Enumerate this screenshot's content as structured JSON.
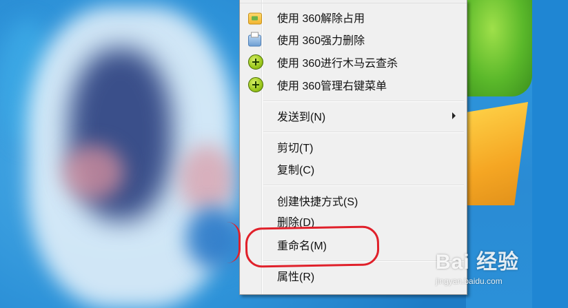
{
  "menu": {
    "items": [
      {
        "label": "使用 360解除占用",
        "icon": "folder-unlock-icon"
      },
      {
        "label": "使用 360强力删除",
        "icon": "shredder-icon"
      },
      {
        "label": "使用 360进行木马云查杀",
        "icon": "360-plus-icon"
      },
      {
        "label": "使用 360管理右键菜单",
        "icon": "360-plus-icon"
      },
      {
        "label": "发送到(N)",
        "submenu": true
      },
      {
        "label": "剪切(T)"
      },
      {
        "label": "复制(C)"
      },
      {
        "label": "创建快捷方式(S)"
      },
      {
        "label": "删除(D)"
      },
      {
        "label": "重命名(M)",
        "highlighted_by_annotation": true
      },
      {
        "label": "属性(R)"
      }
    ]
  },
  "annotation": {
    "color": "#e0202a",
    "target": "重命名(M)"
  },
  "watermark": {
    "logo": "Bai 经验",
    "url": "jingyan.baidu.com"
  }
}
